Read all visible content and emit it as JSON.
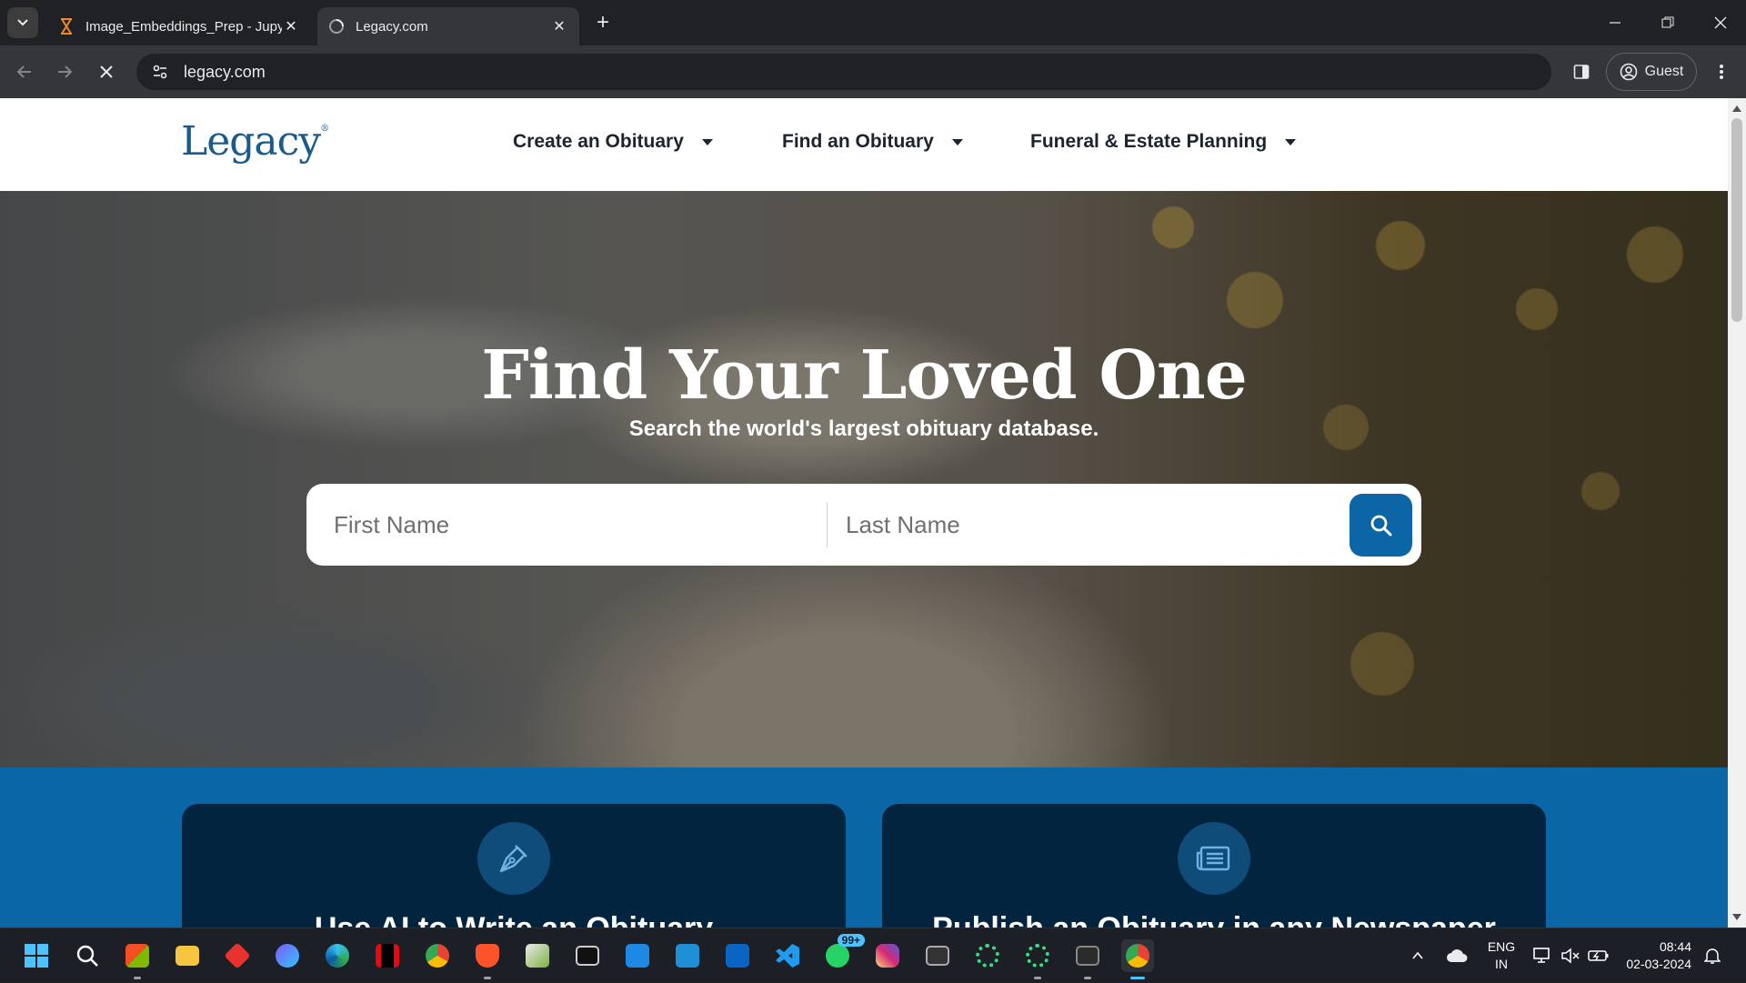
{
  "browser": {
    "tabs": [
      {
        "title": "Image_Embeddings_Prep - Jupyter",
        "active": false
      },
      {
        "title": "Legacy.com",
        "active": true
      }
    ],
    "url": "legacy.com",
    "profile_label": "Guest"
  },
  "site": {
    "logo": "Legacy",
    "logo_mark": "®",
    "nav": [
      {
        "label": "Create an Obituary"
      },
      {
        "label": "Find an Obituary"
      },
      {
        "label": "Funeral & Estate Planning"
      }
    ]
  },
  "hero": {
    "title": "Find Your Loved One",
    "subtitle": "Search the world's largest obituary database.",
    "first_name_placeholder": "First Name",
    "last_name_placeholder": "Last Name"
  },
  "cards": [
    {
      "title": "Use AI to Write an Obituary",
      "icon": "pen-nib-icon"
    },
    {
      "title": "Publish an Obituary in any Newspaper",
      "icon": "newspaper-icon"
    }
  ],
  "taskbar": {
    "whatsapp_badge": "99+",
    "lang_line1": "ENG",
    "lang_line2": "IN",
    "time": "08:44",
    "date": "02-03-2024"
  },
  "colors": {
    "brand_blue": "#0c66a5",
    "card_navy": "#03243f",
    "logo_blue": "#1a5b8c"
  }
}
